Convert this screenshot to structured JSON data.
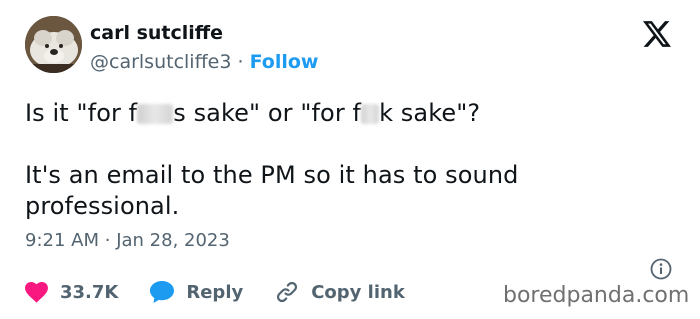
{
  "author": {
    "name": "carl sutcliffe",
    "handle": "@carlsutcliffe3",
    "separator": "·",
    "follow_label": "Follow"
  },
  "tweet": {
    "line1_a": "Is it \"for f",
    "line1_b": "s sake\" or \"for f",
    "line1_c": "k sake\"?",
    "paragraph2": "It's an email to the PM so it has to sound professional."
  },
  "meta": {
    "time": "9:21 AM",
    "separator": "·",
    "date": "Jan 28, 2023"
  },
  "actions": {
    "likes_count": "33.7K",
    "reply_label": "Reply",
    "copy_link_label": "Copy link"
  },
  "watermark": "boredpanda.com",
  "icons": {
    "like": "heart-icon",
    "reply": "speech-bubble-icon",
    "copy": "link-icon",
    "info": "info-icon",
    "brand": "x-logo-icon"
  },
  "colors": {
    "follow": "#1d9bf0",
    "like": "#f91880",
    "reply": "#1d9bf0",
    "copy": "#536471",
    "muted": "#536471"
  }
}
